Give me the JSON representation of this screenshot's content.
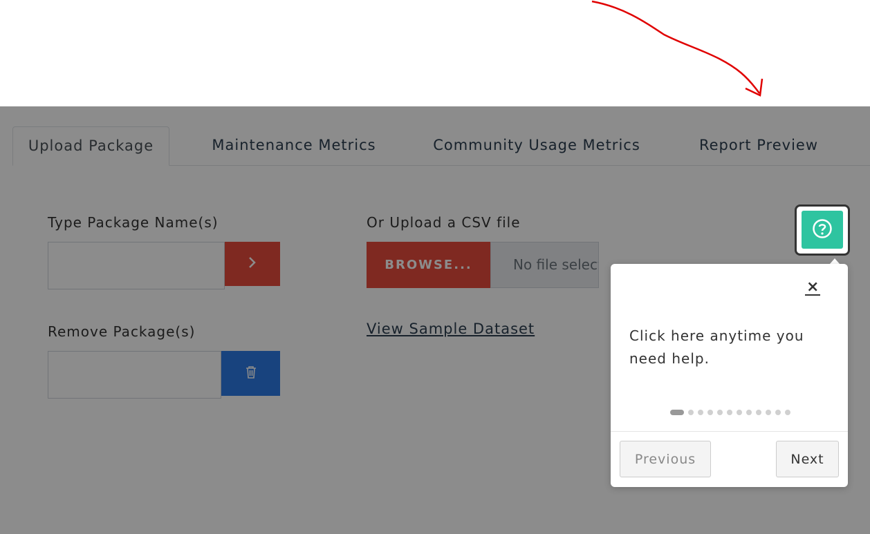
{
  "tabs": [
    {
      "label": "Upload Package"
    },
    {
      "label": "Maintenance Metrics"
    },
    {
      "label": "Community Usage Metrics"
    },
    {
      "label": "Report Preview"
    }
  ],
  "form": {
    "package_name_label": "Type Package Name(s)",
    "package_name_value": "",
    "remove_label": "Remove Package(s)",
    "remove_value": "",
    "csv_label": "Or Upload a CSV file",
    "browse_label": "BROWSE...",
    "file_status": "No file selected",
    "sample_link": "View Sample Dataset"
  },
  "tour": {
    "help_icon": "question-circle-icon",
    "close_glyph": "×",
    "message": "Click here anytime you need help.",
    "step_current": 1,
    "step_total": 12,
    "previous_label": "Previous",
    "next_label": "Next"
  },
  "colors": {
    "accent_red": "#e74c3c",
    "accent_blue": "#2c7be5",
    "help_green": "#2ec4a0",
    "annotation_red": "#e00000"
  }
}
